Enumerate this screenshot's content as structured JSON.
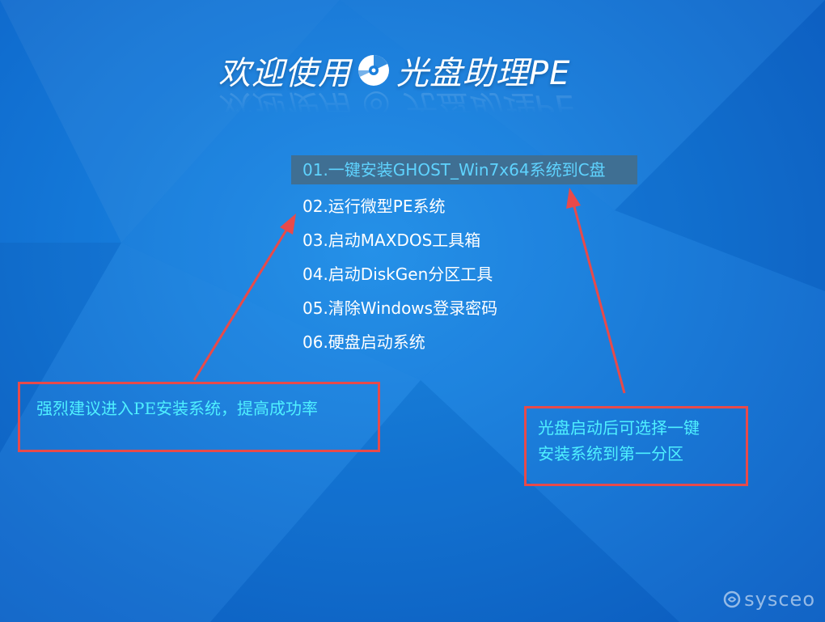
{
  "screen": {
    "title_part1": "欢迎使用",
    "title_part2": "光盘助理PE",
    "disc_icon": "disc-icon",
    "watermark": "sysceo"
  },
  "menu": {
    "selected_index": 0,
    "items": [
      {
        "label": "01.一键安装GHOST_Win7x64系统到C盘"
      },
      {
        "label": "02.运行微型PE系统"
      },
      {
        "label": "03.启动MAXDOS工具箱"
      },
      {
        "label": "04.启动DiskGen分区工具"
      },
      {
        "label": "05.清除Windows登录密码"
      },
      {
        "label": "06.硬盘启动系统"
      }
    ]
  },
  "annotations": {
    "left_text": "强烈建议进入PE安装系统，提高成功率",
    "right_line1": "光盘启动后可选择一键",
    "right_line2": "安装系统到第一分区"
  },
  "colors": {
    "background": "#1478d8",
    "selected_bg": "#3f6f93",
    "selected_text": "#5fd3ff",
    "annotation_border": "#e84a4a",
    "annotation_text": "#4ff0ff"
  }
}
